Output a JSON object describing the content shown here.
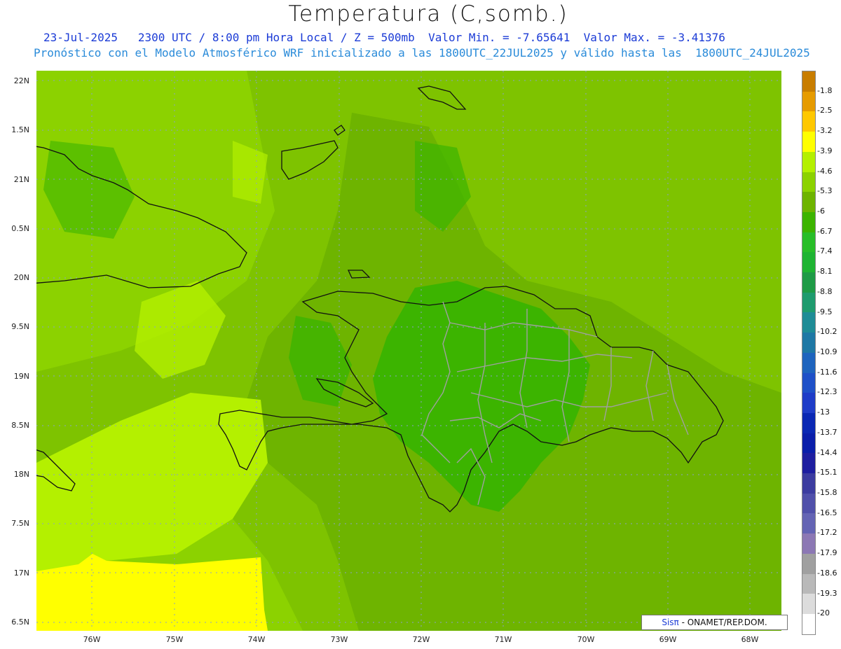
{
  "title": "Temperatura (C,somb.)",
  "subtitle_line1": "23-Jul-2025   2300 UTC / 8:00 pm Hora Local / Z = 500mb  Valor Min. = -7.65641  Valor Max. = -3.41376",
  "subtitle_line2": "Pronóstico con el Modelo Atmosférico WRF inicializado a las 1800UTC_22JUL2025 y válido hasta las  1800UTC_24JUL2025",
  "y_ticks": [
    "22N",
    "1.5N",
    "21N",
    "0.5N",
    "20N",
    "9.5N",
    "19N",
    "8.5N",
    "18N",
    "7.5N",
    "17N",
    "6.5N"
  ],
  "x_ticks": [
    "76W",
    "75W",
    "74W",
    "73W",
    "72W",
    "71W",
    "70W",
    "69W",
    "68W"
  ],
  "colorbar": {
    "labels": [
      "-1.8",
      "-2.5",
      "-3.2",
      "-3.9",
      "-4.6",
      "-5.3",
      "-6",
      "-6.7",
      "-7.4",
      "-8.1",
      "-8.8",
      "-9.5",
      "-10.2",
      "-10.9",
      "-11.6",
      "-12.3",
      "-13",
      "-13.7",
      "-14.4",
      "-15.1",
      "-15.8",
      "-16.5",
      "-17.2",
      "-17.9",
      "-18.6",
      "-19.3",
      "-20"
    ],
    "colors": [
      "#c87d00",
      "#e69b00",
      "#ffc800",
      "#ffff00",
      "#b4f000",
      "#8cd200",
      "#6eb400",
      "#3cb400",
      "#28be28",
      "#1eb432",
      "#1e9b46",
      "#1e9b6e",
      "#1e8c96",
      "#1e78a5",
      "#1e64be",
      "#1e50c8",
      "#1e3cc8",
      "#0a28b4",
      "#0a1eaa",
      "#1e1ea0",
      "#3c3ca0",
      "#5050aa",
      "#6464b4",
      "#8c78b4",
      "#a0a0a0",
      "#b9b9b9",
      "#dcdcdc",
      "#ffffff"
    ]
  },
  "credit": {
    "brand": "Sisπ",
    "text": " - ONAMET/REP.DOM."
  }
}
